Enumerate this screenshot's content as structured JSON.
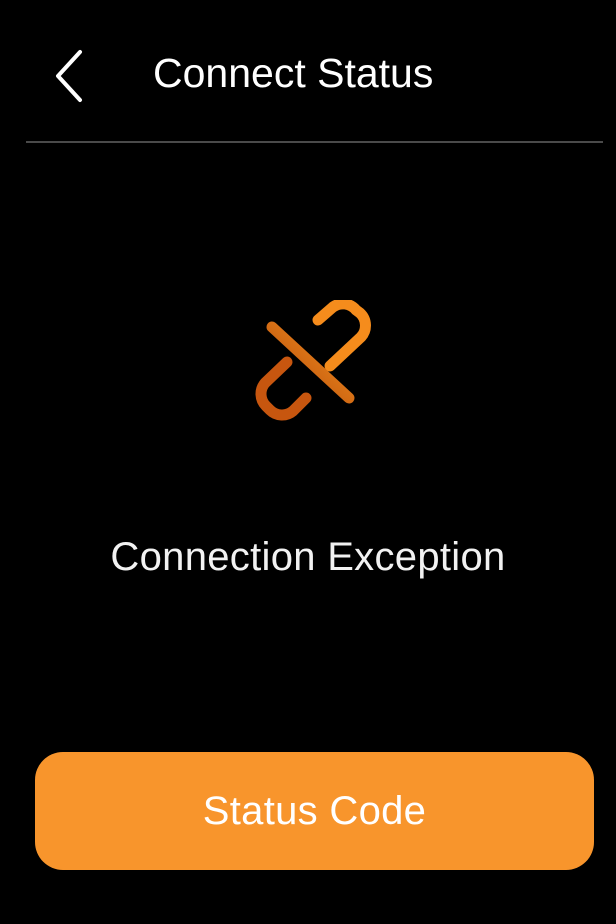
{
  "header": {
    "title": "Connect Status",
    "back_icon": "chevron-left-icon"
  },
  "status": {
    "icon": "broken-link-icon",
    "message": "Connection Exception"
  },
  "actions": {
    "status_code_label": "Status Code"
  },
  "colors": {
    "background": "#000000",
    "accent": "#f8952c",
    "icon_gradient_light": "#f28a1e",
    "icon_gradient_dark": "#b84a0c",
    "divider": "#4a4a4a",
    "text": "#ffffff"
  }
}
